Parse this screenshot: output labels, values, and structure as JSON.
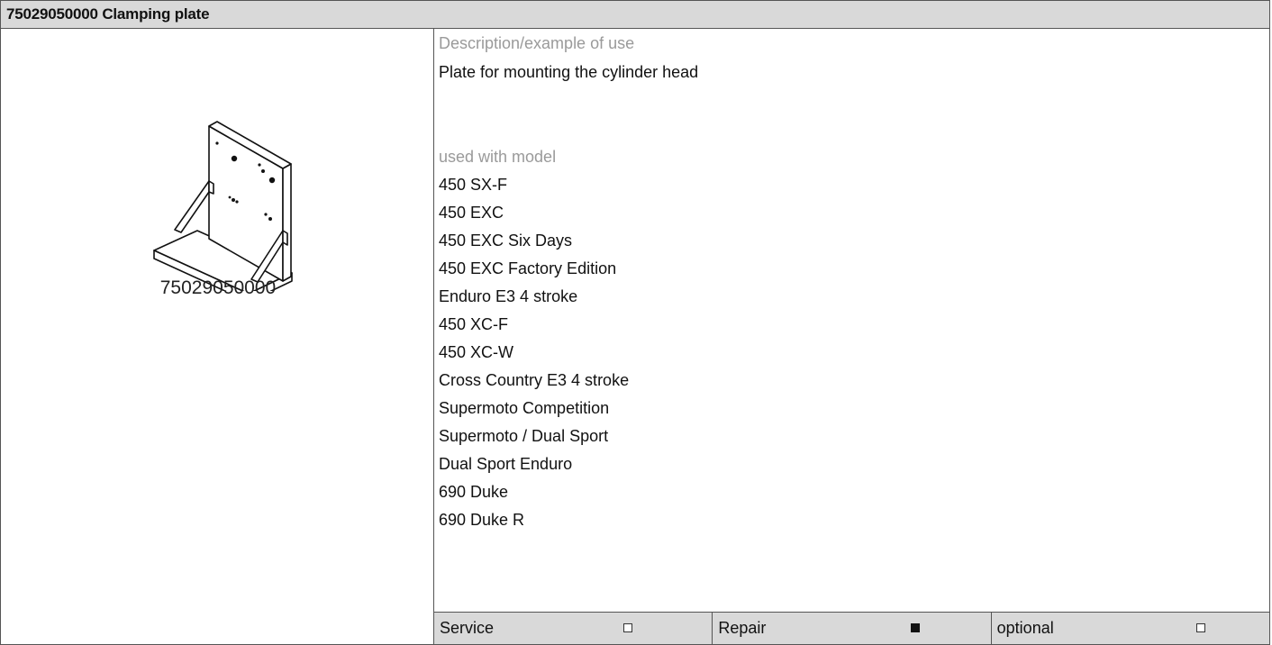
{
  "header": {
    "title": "75029050000 Clamping plate"
  },
  "left": {
    "part_number": "75029050000",
    "image_icon": "clamping-plate-illustration"
  },
  "details": {
    "description_label": "Description/example of use",
    "description_text": "Plate for mounting the cylinder head",
    "models_label": "used with model",
    "models": [
      "450 SX-F",
      "450 EXC",
      "450 EXC Six Days",
      "450 EXC Factory Edition",
      "Enduro E3 4 stroke",
      "450 XC-F",
      "450 XC-W",
      "Cross Country E3 4 stroke",
      "Supermoto Competition",
      "Supermoto / Dual Sport",
      "Dual Sport Enduro",
      "690 Duke",
      "690 Duke R"
    ]
  },
  "footer": {
    "items": [
      {
        "label": "Service",
        "checked": false
      },
      {
        "label": "Repair",
        "checked": true
      },
      {
        "label": "optional",
        "checked": false
      }
    ]
  }
}
